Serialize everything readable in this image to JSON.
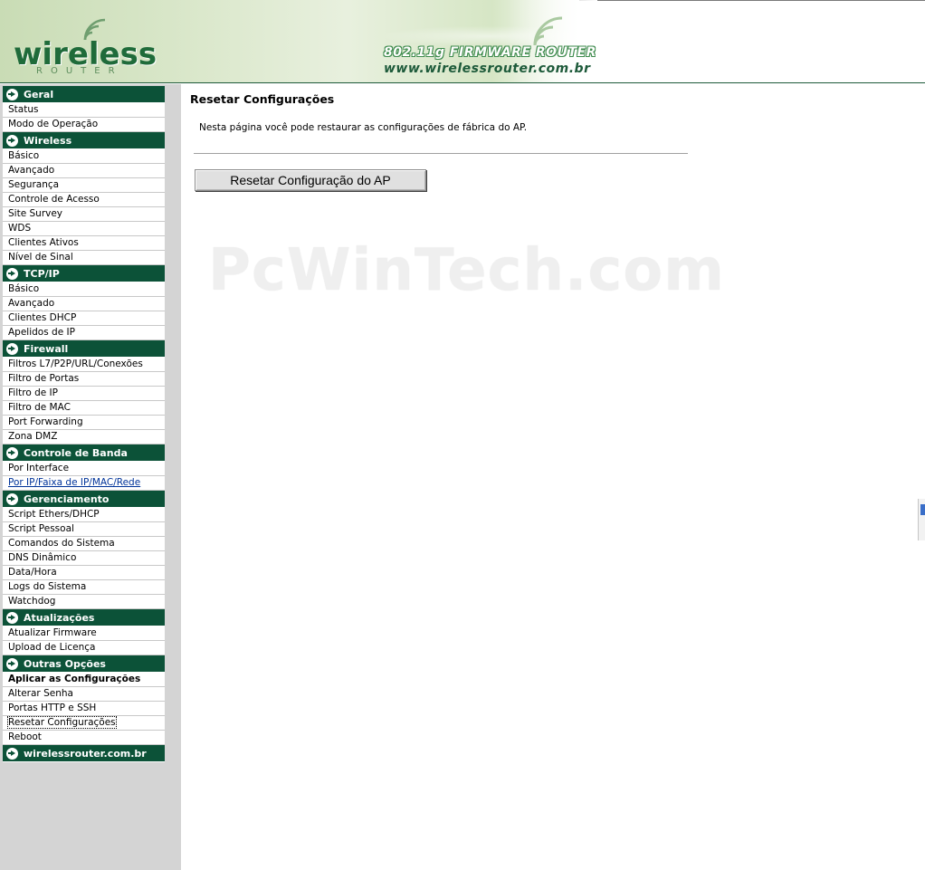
{
  "header": {
    "logo_main": "wireless",
    "logo_sub": "ROUTER",
    "tagline": "802.11g FIRMWARE ROUTER",
    "url": "www.wirelessrouter.com.br",
    "accent_color": "#1d5a3a"
  },
  "sidebar": {
    "sections": [
      {
        "title": "Geral",
        "icon": "arrow-circle-icon",
        "items": [
          "Status",
          "Modo de Operação"
        ]
      },
      {
        "title": "Wireless",
        "icon": "arrow-circle-icon",
        "items": [
          "Básico",
          "Avançado",
          "Segurança",
          "Controle de Acesso",
          "Site Survey",
          "WDS",
          "Clientes Ativos",
          "Nível de Sinal"
        ]
      },
      {
        "title": "TCP/IP",
        "icon": "arrow-circle-icon",
        "items": [
          "Básico",
          "Avançado",
          "Clientes DHCP",
          "Apelidos de IP"
        ]
      },
      {
        "title": "Firewall",
        "icon": "arrow-circle-icon",
        "items": [
          "Filtros L7/P2P/URL/Conexões",
          "Filtro de Portas",
          "Filtro de IP",
          "Filtro de MAC",
          "Port Forwarding",
          "Zona DMZ"
        ]
      },
      {
        "title": "Controle de Banda",
        "icon": "arrow-circle-icon",
        "items": [
          "Por Interface",
          "Por IP/Faixa de IP/MAC/Rede"
        ]
      },
      {
        "title": "Gerenciamento",
        "icon": "arrow-circle-icon",
        "items": [
          "Script Ethers/DHCP",
          "Script Pessoal",
          "Comandos do Sistema",
          "DNS Dinâmico",
          "Data/Hora",
          "Logs do Sistema",
          "Watchdog"
        ]
      },
      {
        "title": "Atualizações",
        "icon": "arrow-circle-icon",
        "items": [
          "Atualizar Firmware",
          "Upload de Licença"
        ]
      },
      {
        "title": "Outras Opções",
        "icon": "arrow-circle-icon",
        "items": [
          "Aplicar as Configurações",
          "Alterar Senha",
          "Portas HTTP e SSH",
          "Resetar Configurações",
          "Reboot"
        ]
      },
      {
        "title": "wirelessrouter.com.br",
        "icon": "arrow-circle-icon",
        "items": []
      }
    ],
    "header_color": "#0c5238",
    "link_item": "Por IP/Faixa de IP/MAC/Rede",
    "bold_item": "Aplicar as Configurações",
    "active_item": "Resetar Configurações"
  },
  "main": {
    "title": "Resetar Configurações",
    "description": "Nesta página você pode restaurar as configurações de fábrica do AP.",
    "reset_button": "Resetar Configuração do AP"
  },
  "watermark": "PcWinTech.com"
}
